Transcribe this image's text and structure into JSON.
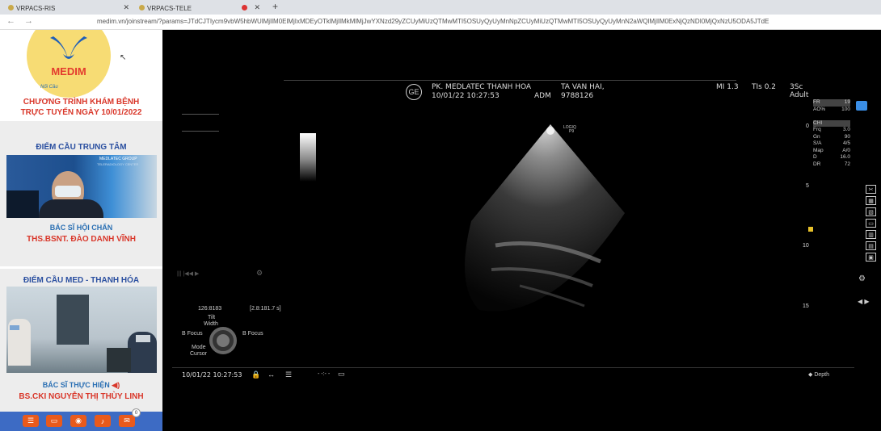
{
  "browser": {
    "tabs": [
      {
        "label": "VRPACS-RIS"
      },
      {
        "label": "VRPACS-TELE"
      },
      {
        "label": ""
      }
    ],
    "url": "medim.vn/joinstream/?params=JTdCJTIycm9vbW5hbWUlMjIlM0ElMjIxMDEyOTklMjIlMkMlMjJwYXNzd29yZCUyMiUzQTMwMTI5OSUyQyUyMnNpZCUyMiUzQTMwMTI5OSUyQyUyMnN2aWQlMjIlM0ExNjQzNDI0MjQxNzU5ODA5JTdE"
  },
  "sidebar": {
    "logo_text": "MEDIM",
    "slogan": "Nối Cầu",
    "program_title_line1": "CHƯƠNG TRÌNH KHÁM BỆNH",
    "program_title_line2": "TRỰC TUYẾN NGÀY 10/01/2022",
    "panel1": {
      "title": "ĐIỂM CẦU TRUNG TÂM",
      "video_caption": "MEDLATEC GROUP",
      "video_caption2": "TELERADIOLOGY CENTER",
      "role": "BÁC SĨ HỘI CHẨN",
      "doctor": "THS.BSNT. ĐÀO DANH VĨNH"
    },
    "panel2": {
      "title": "ĐIỂM CẦU MED - THANH HÓA",
      "role": "BÁC SĨ THỰC HIỆN",
      "doctor": "BS.CKI NGUYỄN THỊ THÙY LINH"
    },
    "toolbar": {
      "chat_badge": "0"
    }
  },
  "ultrasound": {
    "facility": "PK. MEDLATEC THANH HOA",
    "datetime": "10/01/22 10:27:53",
    "operator": "ADM",
    "patient_name": "TA VAN HAI,",
    "patient_id": "9788126",
    "mi": "MI 1.3",
    "tis": "TIs 0.2",
    "probe": "3Sc",
    "preset": "Adult",
    "probe_label": "LOGIQ",
    "probe_label2": "P9",
    "params": [
      {
        "k": "FR",
        "v": "19"
      },
      {
        "k": "AO%",
        "v": "100"
      },
      {
        "k": "",
        "v": ""
      },
      {
        "k": "CHI",
        "v": ""
      },
      {
        "k": "Frq",
        "v": "3.0"
      },
      {
        "k": "Gn",
        "v": "90"
      },
      {
        "k": "S/A",
        "v": "4/5"
      },
      {
        "k": "Map",
        "v": "A/0"
      },
      {
        "k": "D",
        "v": "16.0"
      },
      {
        "k": "DR",
        "v": "72"
      }
    ],
    "depth_ticks": [
      "0",
      "5",
      "10",
      "15"
    ],
    "cine_info": "126:8183",
    "cine_range": "[2.8:181.7 s]",
    "knob_top": "Tilt",
    "knob_top2": "Width",
    "knob_left": "B Focus",
    "knob_right": "B Focus",
    "knob_bottom": "Mode",
    "knob_bottom2": "Cursor",
    "footer_time": "10/01/22 10:27:53",
    "footer_depth": "Depth",
    "colors": {
      "accent": "#3d6bc4",
      "alert": "#d9372a",
      "button": "#e95a1c"
    }
  }
}
